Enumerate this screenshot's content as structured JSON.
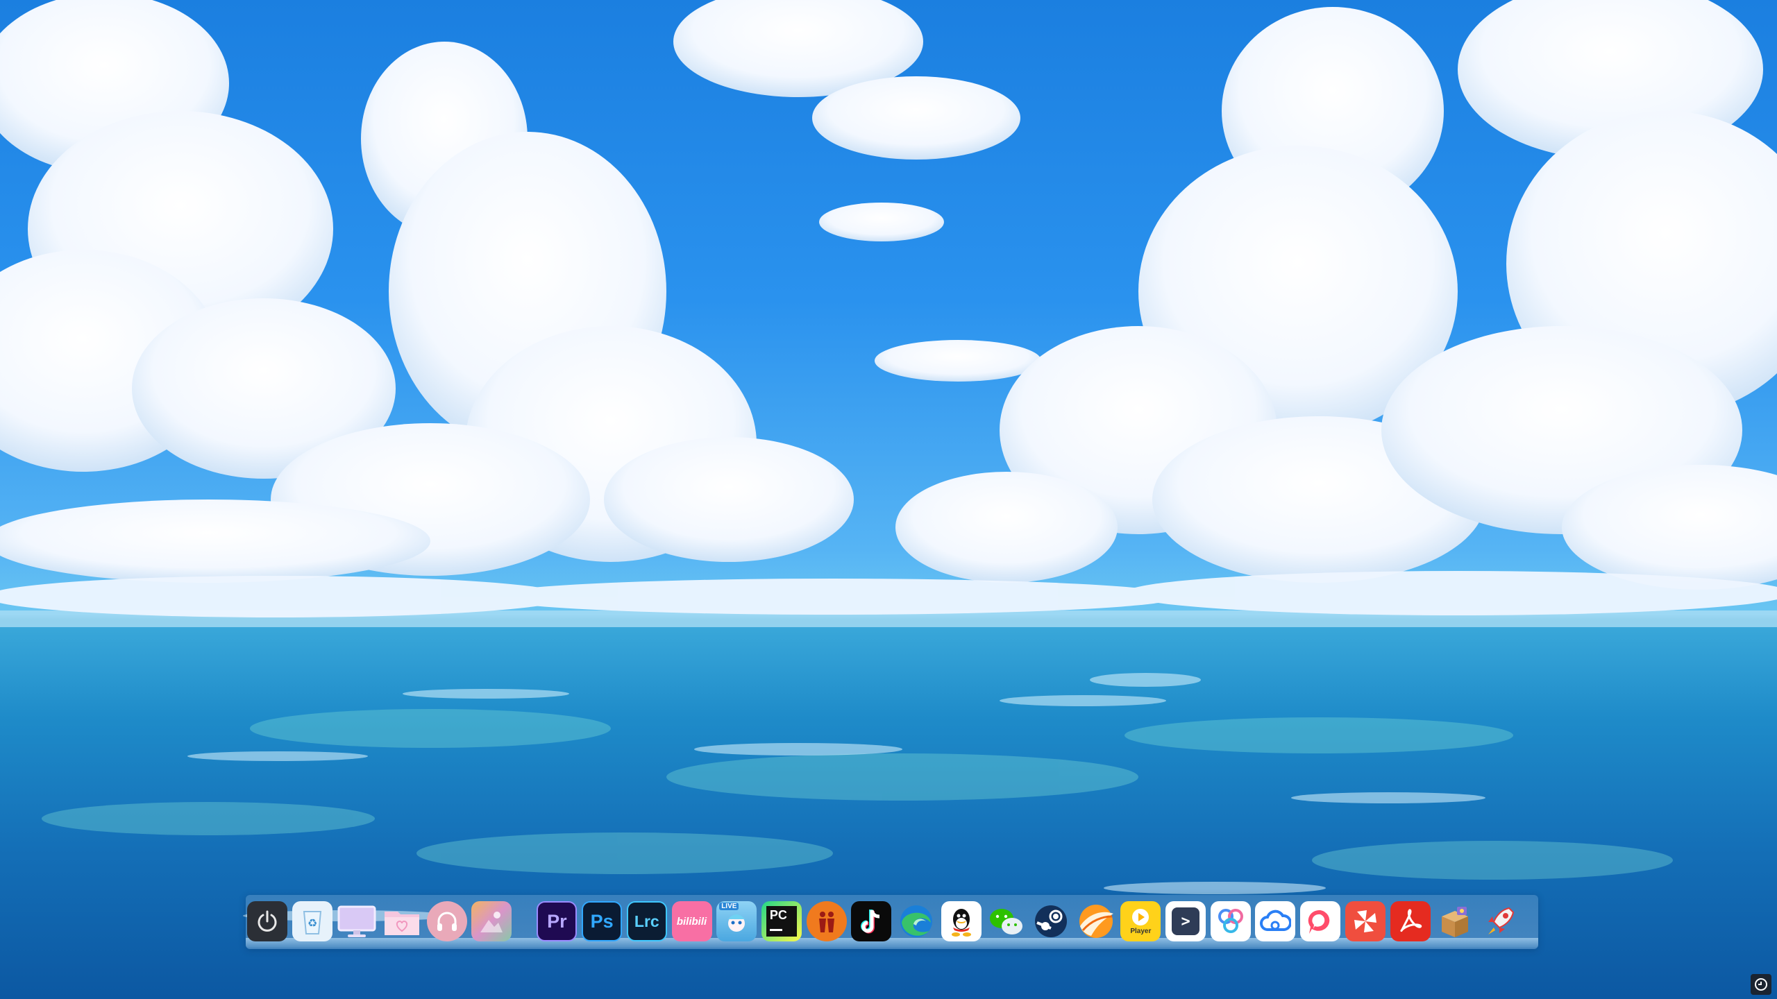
{
  "desktop": {
    "wallpaper": "anime-style blue sky with cumulus clouds over ocean",
    "colors": {
      "sky_top": "#1b7fe0",
      "horizon": "#6ac6f2",
      "ocean": "#0f6db6",
      "cloud": "#ffffff"
    }
  },
  "dock": {
    "items": [
      {
        "name": "power-icon",
        "label": "",
        "bg": "#2b2f36"
      },
      {
        "name": "recycle-bin-icon",
        "label": "",
        "bg": "#dfeefa"
      },
      {
        "name": "monitor-icon",
        "label": "",
        "bg": "transparent"
      },
      {
        "name": "folder-icon",
        "label": "",
        "bg": "#f6cfe3"
      },
      {
        "name": "headphones-icon",
        "label": "",
        "bg": "#e9a9b9"
      },
      {
        "name": "gallery-icon",
        "label": "",
        "bg": "#e8c26a"
      },
      {
        "name": "premiere-pro-icon",
        "label": "Pr",
        "bg": "#1f0a52"
      },
      {
        "name": "photoshop-icon",
        "label": "Ps",
        "bg": "#0a1b33"
      },
      {
        "name": "lightroom-classic-icon",
        "label": "Lrc",
        "bg": "#0b1d33"
      },
      {
        "name": "bilibili-icon",
        "label": "bilibili",
        "bg": "#f86fa4"
      },
      {
        "name": "live-wallpaper-icon",
        "label": "LIVE",
        "bg": "#8fd3f5"
      },
      {
        "name": "pycharm-icon",
        "label": "PC",
        "bg": "#111111"
      },
      {
        "name": "people-app-icon",
        "label": "",
        "bg": "#f07a1e"
      },
      {
        "name": "tiktok-icon",
        "label": "",
        "bg": "#0a0a0a"
      },
      {
        "name": "edge-icon",
        "label": "",
        "bg": "transparent"
      },
      {
        "name": "qq-icon",
        "label": "",
        "bg": "#ffffff"
      },
      {
        "name": "wechat-icon",
        "label": "",
        "bg": "transparent"
      },
      {
        "name": "steam-icon",
        "label": "",
        "bg": "transparent"
      },
      {
        "name": "browser-icon",
        "label": "",
        "bg": "transparent"
      },
      {
        "name": "potplayer-icon",
        "label": "Player",
        "bg": "#ffd21a"
      },
      {
        "name": "terminal-icon",
        "label": ">",
        "bg": "#ffffff"
      },
      {
        "name": "connect-icon",
        "label": "",
        "bg": "#ffffff"
      },
      {
        "name": "cloud-drive-icon",
        "label": "",
        "bg": "#ffffff"
      },
      {
        "name": "chat-icon",
        "label": "",
        "bg": "#ffffff"
      },
      {
        "name": "pinwheel-app-icon",
        "label": "",
        "bg": "#f04e3e"
      },
      {
        "name": "acrobat-icon",
        "label": "",
        "bg": "#e52b20"
      },
      {
        "name": "package-icon",
        "label": "",
        "bg": "transparent"
      },
      {
        "name": "rocket-icon",
        "label": "",
        "bg": "transparent"
      }
    ]
  },
  "corner": {
    "name": "corner-button-icon"
  }
}
